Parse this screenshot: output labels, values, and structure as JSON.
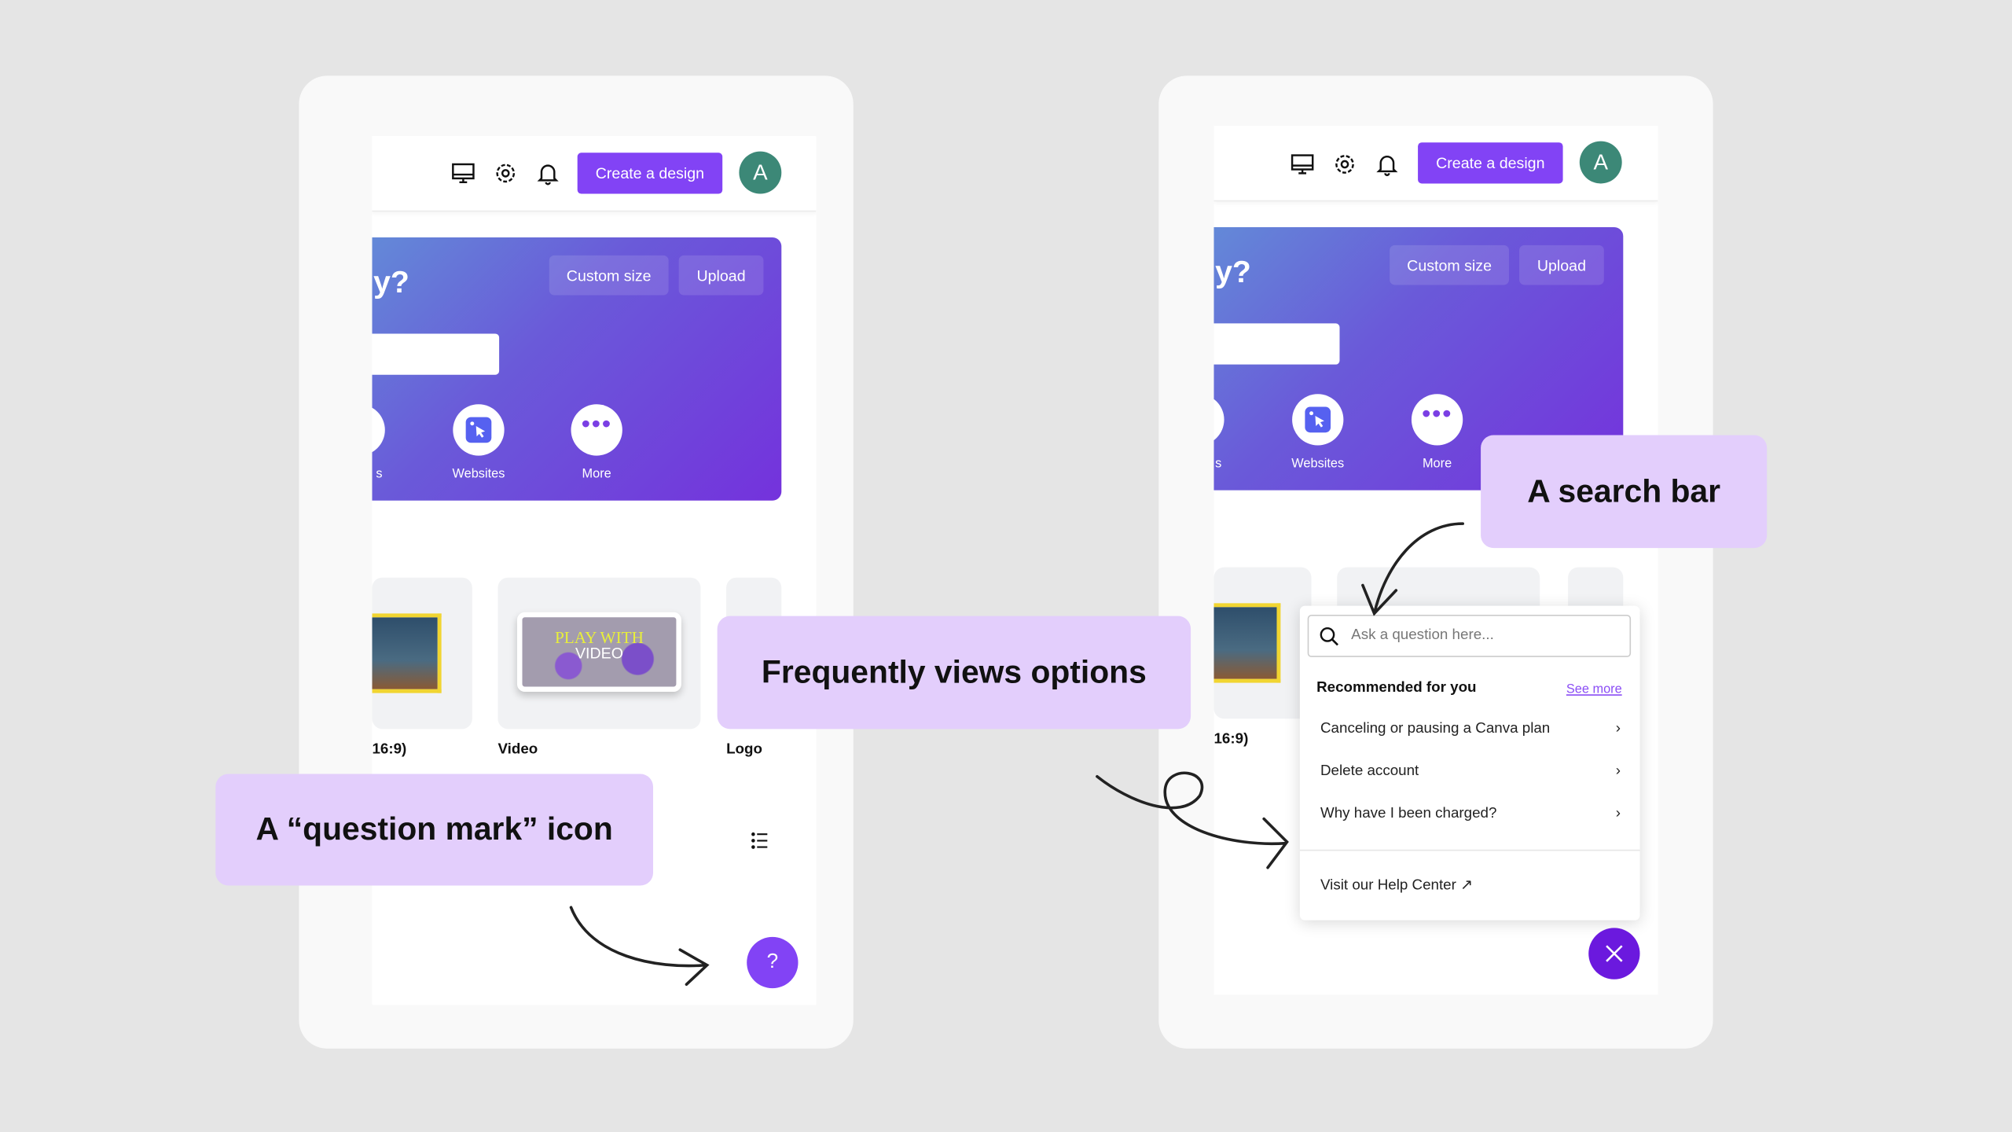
{
  "header": {
    "create_label": "Create a design",
    "avatar_initial": "A",
    "icons": [
      "monitor-icon",
      "gear-icon",
      "bell-icon"
    ]
  },
  "banner": {
    "heading_fragment": "y?",
    "custom_size": "Custom size",
    "upload": "Upload",
    "shortcuts": [
      {
        "label": "s"
      },
      {
        "label": "Websites"
      },
      {
        "label": "More"
      }
    ]
  },
  "templates": [
    {
      "label": "16:9)"
    },
    {
      "label": "Video",
      "thumb_text_1": "PLAY WITH",
      "thumb_text_2": "VIDEO"
    },
    {
      "label": "Logo"
    }
  ],
  "help_button": {
    "icon": "question-mark",
    "glyph": "?"
  },
  "help_popup": {
    "search_placeholder": "Ask a question here...",
    "section_title": "Recommended for you",
    "see_more": "See more",
    "items": [
      {
        "label": "Canceling or pausing a Canva plan"
      },
      {
        "label": "Delete account"
      },
      {
        "label": "Why have I been charged?"
      }
    ],
    "help_center": "Visit our Help Center ↗"
  },
  "annotations": {
    "question_icon": "A “question mark” icon",
    "frequent": "Frequently views options",
    "search_bar": "A search bar"
  },
  "colors": {
    "accent": "#8243f5",
    "close_button": "#6b19de",
    "avatar": "#3c8877",
    "annotation_bg": "#e3cefc"
  }
}
